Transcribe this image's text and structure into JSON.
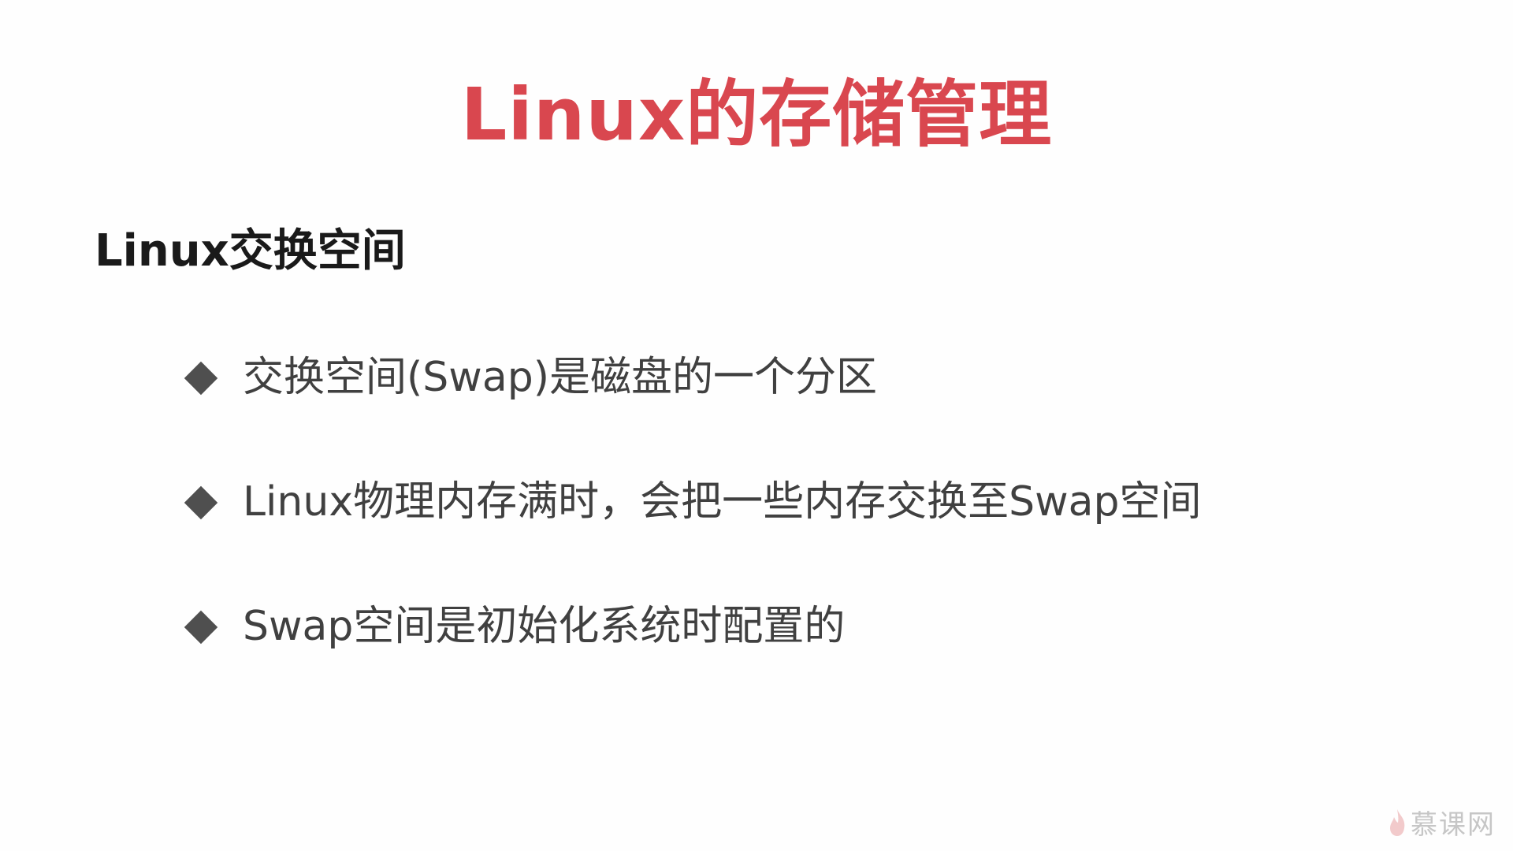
{
  "slide": {
    "title": "Linux的存储管理",
    "subtitle": "Linux交换空间",
    "bullets": [
      {
        "text": "交换空间(Swap)是磁盘的一个分区"
      },
      {
        "text": "Linux物理内存满时，会把一些内存交换至Swap空间"
      },
      {
        "text": "Swap空间是初始化系统时配置的"
      }
    ],
    "bullet_icon": "diamond-bullet-icon",
    "colors": {
      "title": "#d9474f",
      "subtitle": "#1a1a1a",
      "bullet_text": "#404040",
      "bullet_marker": "#4f4f4f"
    }
  },
  "watermark": {
    "text": "慕课网",
    "icon": "flame-logo-icon"
  }
}
